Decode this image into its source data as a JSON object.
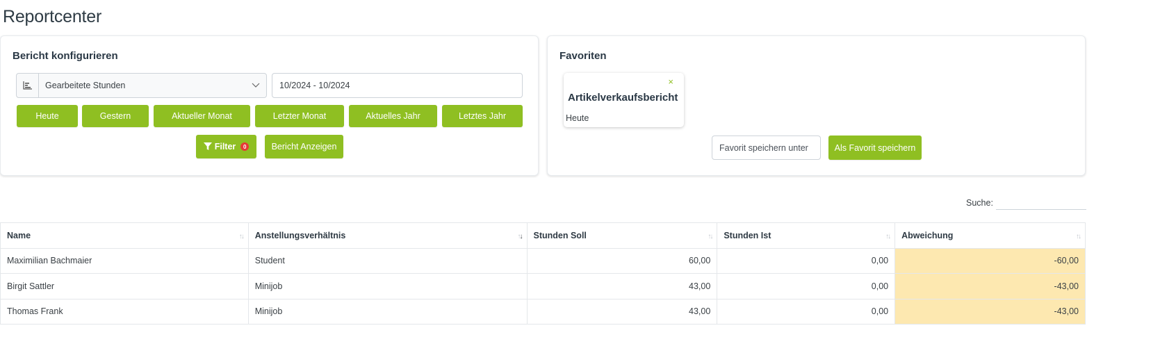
{
  "page": {
    "title": "Reportcenter"
  },
  "config": {
    "title": "Bericht konfigurieren",
    "report_select": {
      "value": "Gearbeitete Stunden",
      "icon": "bar-chart-icon"
    },
    "date_range": "10/2024 - 10/2024",
    "quick_ranges": [
      "Heute",
      "Gestern",
      "Aktueller Monat",
      "Letzter Monat",
      "Aktuelles Jahr",
      "Letztes Jahr"
    ],
    "filter": {
      "label": "Filter",
      "count": "0"
    },
    "show_label": "Bericht Anzeigen"
  },
  "favorites": {
    "title": "Favoriten",
    "items": [
      {
        "name": "Artikelverkaufsbericht",
        "range": "Heute",
        "remove": "×"
      }
    ],
    "save_placeholder": "Favorit speichern unter",
    "save_button": "Als Favorit speichern"
  },
  "table": {
    "search_label": "Suche:",
    "columns": [
      "Name",
      "Anstellungsverhältnis",
      "Stunden Soll",
      "Stunden Ist",
      "Abweichung"
    ],
    "rows": [
      [
        "Maximilian Bachmaier",
        "Student",
        "60,00",
        "0,00",
        "-60,00"
      ],
      [
        "Birgit Sattler",
        "Minijob",
        "43,00",
        "0,00",
        "-43,00"
      ],
      [
        "Thomas Frank",
        "Minijob",
        "43,00",
        "0,00",
        "-43,00"
      ]
    ],
    "highlight_color": "#fde8b0"
  },
  "colors": {
    "accent": "#8fbf22",
    "badge": "#e53935",
    "title": "#2e3b44"
  }
}
